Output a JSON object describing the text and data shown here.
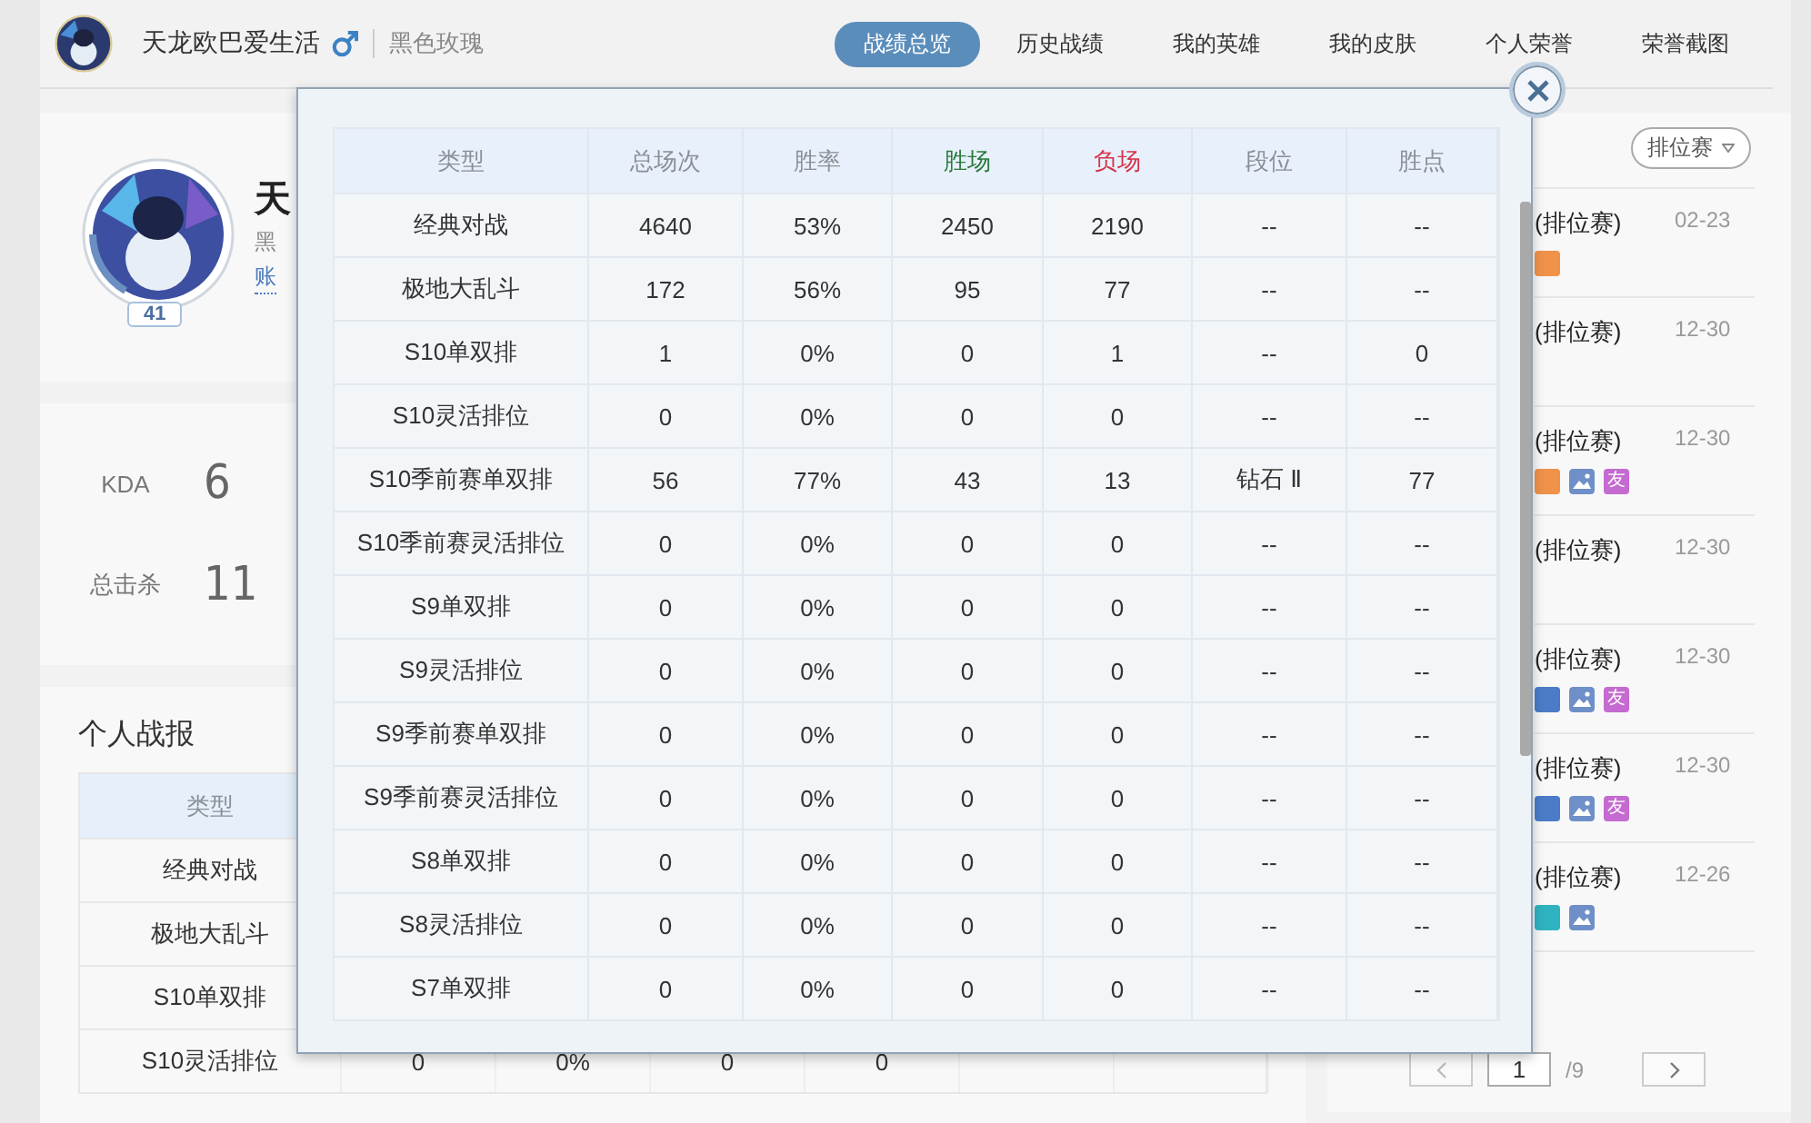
{
  "header": {
    "nickname": "天龙欧巴爱生活",
    "male": true,
    "server": "黑色玫瑰",
    "nav": [
      {
        "label": "战绩总览",
        "selected": true
      },
      {
        "label": "历史战绩",
        "selected": false
      },
      {
        "label": "我的英雄",
        "selected": false
      },
      {
        "label": "我的皮肤",
        "selected": false
      },
      {
        "label": "个人荣誉",
        "selected": false
      },
      {
        "label": "荣誉截图",
        "selected": false
      }
    ]
  },
  "profile": {
    "level": "41",
    "name": "天",
    "server": "黑",
    "account_link": "账"
  },
  "stats": [
    {
      "label": "KDA",
      "value": "6"
    },
    {
      "label": "总击杀",
      "value": "11"
    }
  ],
  "report": {
    "title": "个人战报",
    "columns": [
      "类型"
    ],
    "rows": [
      {
        "cells": [
          "经典对战"
        ]
      },
      {
        "cells": [
          "极地大乱斗"
        ]
      },
      {
        "cells": [
          "S10单双排"
        ]
      },
      {
        "cells": [
          "S10灵活排位",
          "0",
          "0%",
          "0",
          "0"
        ]
      }
    ]
  },
  "matches": {
    "filter": "排位赛",
    "items": [
      {
        "title": "(排位赛)",
        "date": "02-23",
        "tags": [
          {
            "kind": "mark",
            "color": "#f0924a"
          }
        ]
      },
      {
        "title": "(排位赛)",
        "date": "12-30"
      },
      {
        "title": "(排位赛)",
        "date": "12-30",
        "tags": [
          {
            "kind": "mark",
            "color": "#f0924a"
          },
          {
            "kind": "image",
            "color": "#6f8fc8"
          },
          {
            "kind": "text",
            "color": "#c46ad0",
            "text": "友"
          }
        ]
      },
      {
        "title": "(排位赛)",
        "date": "12-30"
      },
      {
        "title": "(排位赛)",
        "date": "12-30",
        "tags": [
          {
            "kind": "mark",
            "color": "#4a7cc8"
          },
          {
            "kind": "image",
            "color": "#6f8fc8"
          },
          {
            "kind": "text",
            "color": "#c46ad0",
            "text": "友"
          }
        ]
      },
      {
        "title": "(排位赛)",
        "date": "12-30",
        "tags": [
          {
            "kind": "mark",
            "color": "#4a7cc8"
          },
          {
            "kind": "image",
            "color": "#6f8fc8"
          },
          {
            "kind": "text",
            "color": "#c46ad0",
            "text": "友"
          }
        ]
      },
      {
        "title": "(排位赛)",
        "date": "12-26",
        "tags": [
          {
            "kind": "mark",
            "color": "#2fb3c0"
          },
          {
            "kind": "image",
            "color": "#6f8fc8"
          }
        ]
      }
    ],
    "pagination": {
      "page": "1",
      "total": "/9"
    }
  },
  "dialog": {
    "columns": [
      {
        "label": "类型",
        "color": "#8a8f96"
      },
      {
        "label": "总场次",
        "color": "#8a8f96"
      },
      {
        "label": "胜率",
        "color": "#8a8f96"
      },
      {
        "label": "胜场",
        "color": "#2b7a3b"
      },
      {
        "label": "负场",
        "color": "#d6334a"
      },
      {
        "label": "段位",
        "color": "#8a8f96"
      },
      {
        "label": "胜点",
        "color": "#8a8f96"
      }
    ],
    "rows": [
      {
        "cells": [
          "经典对战",
          "4640",
          "53%",
          "2450",
          "2190",
          "--",
          "--"
        ]
      },
      {
        "cells": [
          "极地大乱斗",
          "172",
          "56%",
          "95",
          "77",
          "--",
          "--"
        ]
      },
      {
        "cells": [
          "S10单双排",
          "1",
          "0%",
          "0",
          "1",
          "--",
          "0"
        ]
      },
      {
        "cells": [
          "S10灵活排位",
          "0",
          "0%",
          "0",
          "0",
          "--",
          "--"
        ]
      },
      {
        "cells": [
          "S10季前赛单双排",
          "56",
          "77%",
          "43",
          "13",
          "钻石 Ⅱ",
          "77"
        ]
      },
      {
        "cells": [
          "S10季前赛灵活排位",
          "0",
          "0%",
          "0",
          "0",
          "--",
          "--"
        ]
      },
      {
        "cells": [
          "S9单双排",
          "0",
          "0%",
          "0",
          "0",
          "--",
          "--"
        ]
      },
      {
        "cells": [
          "S9灵活排位",
          "0",
          "0%",
          "0",
          "0",
          "--",
          "--"
        ]
      },
      {
        "cells": [
          "S9季前赛单双排",
          "0",
          "0%",
          "0",
          "0",
          "--",
          "--"
        ]
      },
      {
        "cells": [
          "S9季前赛灵活排位",
          "0",
          "0%",
          "0",
          "0",
          "--",
          "--"
        ]
      },
      {
        "cells": [
          "S8单双排",
          "0",
          "0%",
          "0",
          "0",
          "--",
          "--"
        ]
      },
      {
        "cells": [
          "S8灵活排位",
          "0",
          "0%",
          "0",
          "0",
          "--",
          "--"
        ]
      },
      {
        "cells": [
          "S7单双排",
          "0",
          "0%",
          "0",
          "0",
          "--",
          "--"
        ]
      }
    ]
  }
}
